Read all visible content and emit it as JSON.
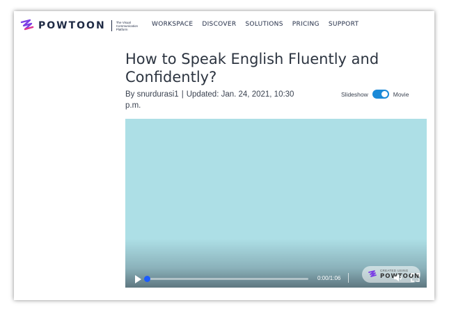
{
  "brand": {
    "name": "POWTOON",
    "tagline_lines": [
      "The Visual",
      "Communication",
      "Platform"
    ]
  },
  "nav": {
    "items": [
      "WORKSPACE",
      "DISCOVER",
      "SOLUTIONS",
      "PRICING",
      "SUPPORT"
    ]
  },
  "article": {
    "title": "How to Speak English Fluently and Confidently?",
    "byline": "By snurdurasi1",
    "separator": "|",
    "updated": "Updated: Jan. 24, 2021, 10:30 p.m."
  },
  "view_toggle": {
    "left_label": "Slideshow",
    "right_label": "Movie",
    "state": "Movie"
  },
  "player": {
    "time": "0:00/1:06",
    "progress_fraction": 0.0,
    "watermark_small": "CREATED USING",
    "watermark_word": "POWTOON"
  },
  "colors": {
    "accent": "#1b8ad8",
    "progress": "#1b5cff",
    "video_bg": "#addfe6",
    "logo_purple": "#7b3fe4",
    "logo_pink": "#e2358a"
  },
  "icons": {
    "logo": "powtoon-logo-icon",
    "play": "play-icon",
    "volume": "volume-icon",
    "fullscreen": "fullscreen-icon"
  }
}
